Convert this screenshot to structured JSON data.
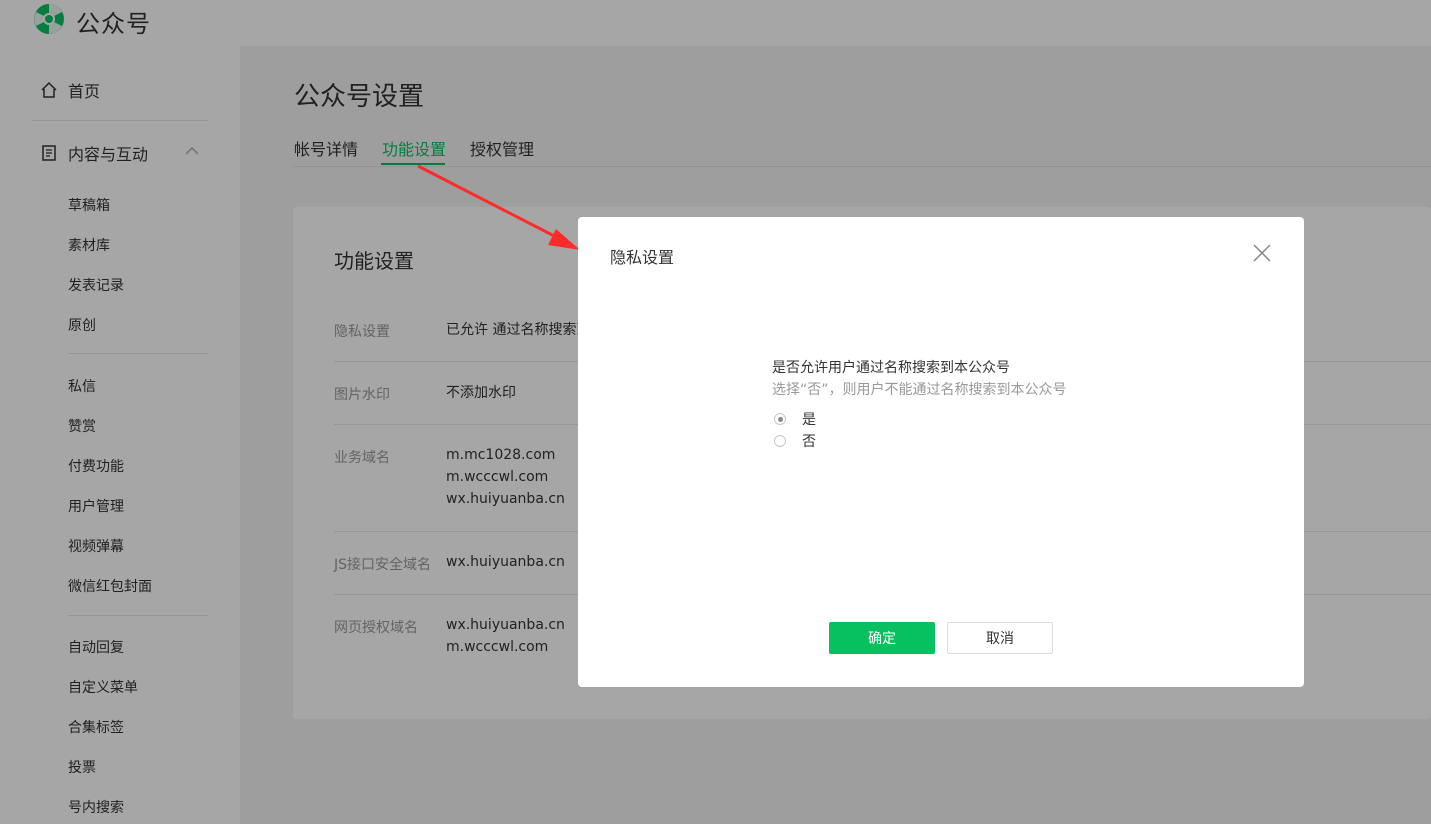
{
  "header": {
    "brand": "公众号",
    "logo_icon": "wechat-official-account-logo-icon",
    "brand_color": "#07c160"
  },
  "sidebar": {
    "home": {
      "label": "首页",
      "icon": "home-icon"
    },
    "content": {
      "label": "内容与互动",
      "icon": "document-icon",
      "expand_icon": "chevron-up-icon"
    },
    "group1": [
      "草稿箱",
      "素材库",
      "发表记录",
      "原创"
    ],
    "group2": [
      "私信",
      "赞赏",
      "付费功能",
      "用户管理",
      "视频弹幕",
      "微信红包封面"
    ],
    "group3": [
      "自动回复",
      "自定义菜单",
      "合集标签",
      "投票",
      "号内搜索"
    ]
  },
  "main": {
    "title": "公众号设置",
    "tabs": [
      "帐号详情",
      "功能设置",
      "授权管理"
    ],
    "active_tab": "功能设置",
    "card_title": "功能设置",
    "rows": [
      {
        "label": "隐私设置",
        "value": "已允许 通过名称搜索到"
      },
      {
        "label": "图片水印",
        "value": "不添加水印"
      },
      {
        "label": "业务域名",
        "values": [
          "m.mc1028.com",
          "m.wcccwl.com",
          "wx.huiyuanba.cn"
        ]
      },
      {
        "label": "JS接口安全域名",
        "values": [
          "wx.huiyuanba.cn"
        ]
      },
      {
        "label": "网页授权域名",
        "values": [
          "wx.huiyuanba.cn",
          "m.wcccwl.com"
        ]
      }
    ]
  },
  "dialog": {
    "title": "隐私设置",
    "close_icon": "close-icon",
    "question": "是否允许用户通过名称搜索到本公众号",
    "hint": "选择“否”，则用户不能通过名称搜索到本公众号",
    "options": [
      "是",
      "否"
    ],
    "selected": "是",
    "confirm": "确定",
    "cancel": "取消"
  },
  "annotation": {
    "icon": "red-arrow-annotation",
    "color": "#ff2a2a"
  }
}
